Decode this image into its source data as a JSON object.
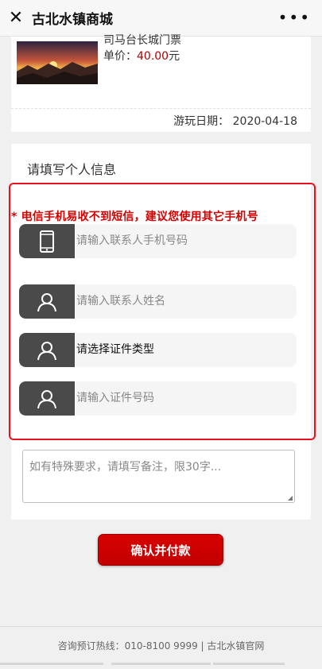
{
  "titlebar": {
    "close_icon": "close-icon",
    "title": "古北水镇商城",
    "more_icon": "more-icon"
  },
  "order": {
    "product_name_partial": "司马台长城门票",
    "price_label": "单价：",
    "price_value": "40.00",
    "price_unit": "元",
    "date_label": "游玩日期：",
    "date_value": "2020-04-18"
  },
  "form": {
    "title": "请填写个人信息",
    "warning": "* 电信手机易收不到短信，建议您使用其它手机号",
    "fields": [
      {
        "icon": "phone-icon",
        "placeholder": "请输入联系人手机号码"
      },
      {
        "icon": "user-icon",
        "placeholder": "请输入联系人姓名"
      },
      {
        "icon": "user-icon",
        "value": "请选择证件类型"
      },
      {
        "icon": "user-icon",
        "placeholder": "请输入证件号码"
      }
    ],
    "remark_placeholder": "如有特殊要求，请填写备注，限30字..."
  },
  "actions": {
    "confirm_label": "确认并付款"
  },
  "footer": {
    "text": "咨询预订热线：010-8100 9999 | 古北水镇官网"
  },
  "colors": {
    "accent": "#c40000",
    "warning": "#d20000",
    "highlight_box": "#e8101a"
  }
}
